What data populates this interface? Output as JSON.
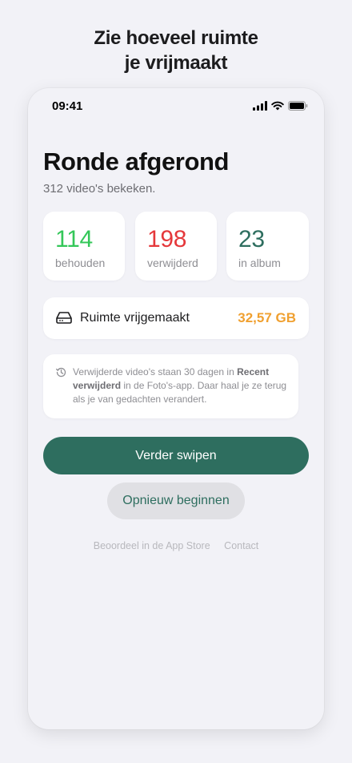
{
  "headline": {
    "line1": "Zie hoeveel ruimte",
    "line2": "je vrijmaakt"
  },
  "status_bar": {
    "time": "09:41",
    "icons": [
      "cellular-signal-icon",
      "wifi-icon",
      "battery-icon"
    ]
  },
  "screen": {
    "title": "Ronde afgerond",
    "subtitle": "312 video's bekeken."
  },
  "stats": [
    {
      "value": "114",
      "label": "behouden",
      "color": "#34c759"
    },
    {
      "value": "198",
      "label": "verwijderd",
      "color": "#e5383b"
    },
    {
      "value": "23",
      "label": "in album",
      "color": "#2e6e5f"
    }
  ],
  "space": {
    "icon": "drive-icon",
    "label": "Ruimte vrijgemaakt",
    "value": "32,57 GB",
    "value_color": "#f0a030"
  },
  "info": {
    "icon": "history-clock-icon",
    "text_before": "Verwijderde video's staan 30 dagen in ",
    "text_bold": "Recent verwijderd",
    "text_after": " in de Foto's-app. Daar haal je ze terug als je van gedachten verandert."
  },
  "buttons": {
    "primary": "Verder swipen",
    "secondary": "Opnieuw beginnen"
  },
  "footer": {
    "rate": "Beoordeel in de App Store",
    "contact": "Contact"
  },
  "colors": {
    "accent": "#2e6e5f",
    "background": "#f2f2f7"
  }
}
